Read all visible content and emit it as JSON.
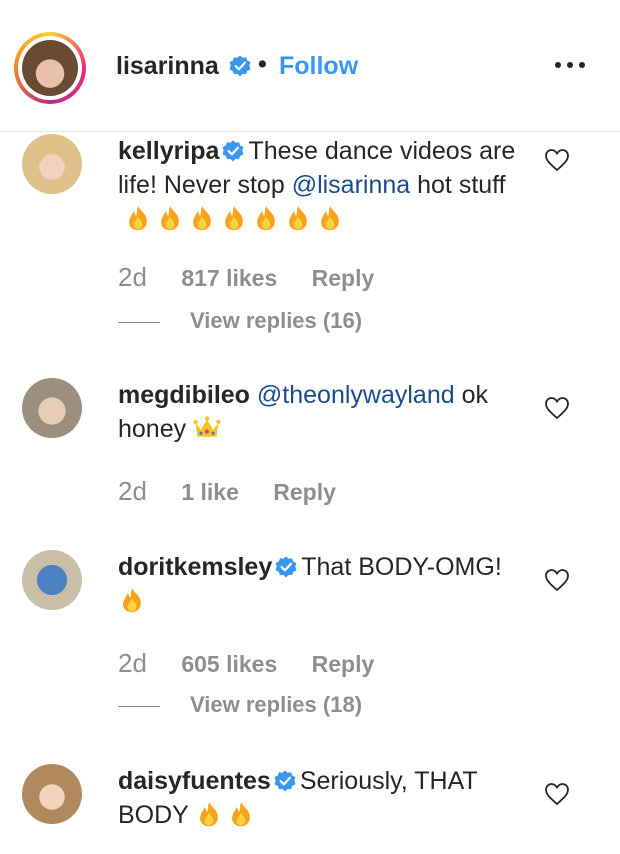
{
  "header": {
    "username": "lisarinna",
    "separator": "•",
    "follow_label": "Follow"
  },
  "comments": [
    {
      "username": "kellyripa",
      "verified": true,
      "text": "These dance videos are life! Never stop ",
      "mention": "@lisarinna",
      "text_after": " hot stuff",
      "emoji_name": "fire",
      "emoji_count": 7,
      "time": "2d",
      "likes": "817 likes",
      "reply_label": "Reply",
      "view_replies": "View replies (16)"
    },
    {
      "username": "megdibileo",
      "verified": false,
      "mention": "@theonlywayland",
      "text_after": " ok honey",
      "emoji_name": "crown",
      "emoji_count": 1,
      "time": "2d",
      "likes": "1 like",
      "reply_label": "Reply"
    },
    {
      "username": "doritkemsley",
      "verified": true,
      "text": "That BODY-OMG!",
      "emoji_name": "fire",
      "emoji_count": 1,
      "time": "2d",
      "likes": "605 likes",
      "reply_label": "Reply",
      "view_replies": "View replies (18)"
    },
    {
      "username": "daisyfuentes",
      "verified": true,
      "text": "Seriously, THAT BODY",
      "emoji_name": "fire",
      "emoji_count": 2
    }
  ],
  "colors": {
    "link": "#3897f0",
    "mention": "#1b4b8c",
    "meta": "#8e8e8e",
    "verified": "#3897f0"
  }
}
